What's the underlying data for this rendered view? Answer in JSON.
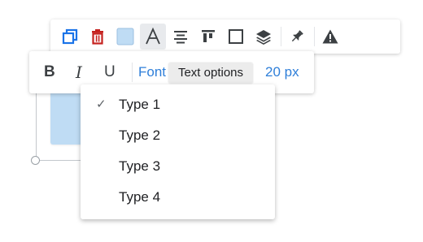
{
  "main_toolbar": {
    "buttons": [
      {
        "name": "duplicate",
        "icon": "duplicate-icon"
      },
      {
        "name": "delete",
        "icon": "trash-icon"
      },
      {
        "name": "fill-color",
        "icon": "fill-color-swatch"
      },
      {
        "name": "text-options",
        "icon": "text-a-icon"
      },
      {
        "name": "align-center",
        "icon": "align-center-icon"
      },
      {
        "name": "align-top",
        "icon": "align-top-icon"
      },
      {
        "name": "border",
        "icon": "border-square-icon"
      },
      {
        "name": "layers",
        "icon": "layers-icon"
      },
      {
        "name": "pin",
        "icon": "pin-icon"
      },
      {
        "name": "warning",
        "icon": "warning-icon"
      }
    ],
    "colors": {
      "icon": "#3c4043",
      "delete": "#c5221f",
      "fill_swatch": "#bfdcf4",
      "accent": "#1a73e8"
    }
  },
  "text_toolbar": {
    "bold": "B",
    "italic": "I",
    "underline": "U",
    "font_label": "Font",
    "font_size": "20 px",
    "accent_color": "#2f7fd9"
  },
  "tooltip": {
    "text": "Text options"
  },
  "font_dropdown": {
    "items": [
      {
        "label": "Type 1",
        "checked": true
      },
      {
        "label": "Type 2",
        "checked": false
      },
      {
        "label": "Type 3",
        "checked": false
      },
      {
        "label": "Type 4",
        "checked": false
      }
    ],
    "check_glyph": "✓"
  }
}
